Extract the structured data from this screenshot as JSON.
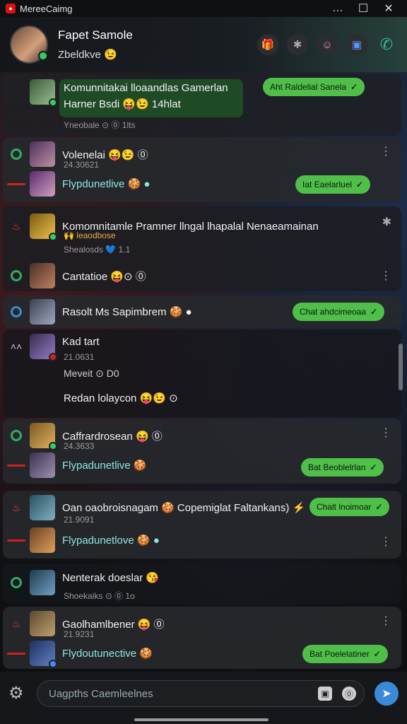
{
  "window": {
    "title": "MereeCaimg"
  },
  "header": {
    "name": "Fapet Samole",
    "status": "Zbeldkve 😉",
    "icons": [
      "gift-icon",
      "settings-icon",
      "avatar-icon",
      "square-icon",
      "phone-icon"
    ]
  },
  "cards": [
    {
      "text": "Komunnitakai lloaandlas Gamerlan",
      "text2": "Harner Bsdi 😝😉 14hlat",
      "sub": "Yneobale ⊙ ⓪ 1lts",
      "pill": "Aht Raldelial Sanela"
    },
    {
      "text": "Volenelai 😝😉 ⓪",
      "sub": "24.30621",
      "text2": "Flypdunetlive 🍪 ●",
      "pill": "Iat Eaelarluel"
    },
    {
      "text": "Komomnitamle Pramner llngal lhapalal Nenaeamainan",
      "text2": "🙌 leaodbose",
      "sub": "Shealosds 💙 1.1",
      "text3": "Cantatioe 😝⊙ ⓪"
    },
    {
      "text": "Rasolt Ms Sapimbrem 🍪 ●",
      "pill": "Chat ahdcimeoaa"
    },
    {
      "text": "Kad tart",
      "sub": "21.0631",
      "text2": "Meveit ⊙ D0",
      "text3": "Redan lolaycon 😝😉 ⊙"
    },
    {
      "text": "Caffrardrosean 😝 ⓪",
      "sub": "24.3633",
      "text2": "Flypadunetlive 🍪",
      "pill": "Bat Beoblelrlan"
    },
    {
      "text": "Oan oaobroisnagam 🍪 Copemiglat Faltankans) ⚡",
      "pill": "Chalt lnoimoar",
      "sub": "21.9091",
      "text2": "Flypadunetlove 🍪 ●"
    },
    {
      "text": "Nenterak doeslar 😘",
      "sub": "Shoekaiks ⊙ ⓪ 1o"
    },
    {
      "text": "Gaolhamlbener 😝 ⓪",
      "sub": "21.9231",
      "text2": "Flydoutunective 🍪",
      "pill": "Bat Poelelatiner"
    }
  ],
  "composer": {
    "placeholder": "Uagpths Caemleelnes"
  },
  "colors": {
    "accent_green": "#4fbf4a",
    "send_blue": "#3b8ad8"
  }
}
